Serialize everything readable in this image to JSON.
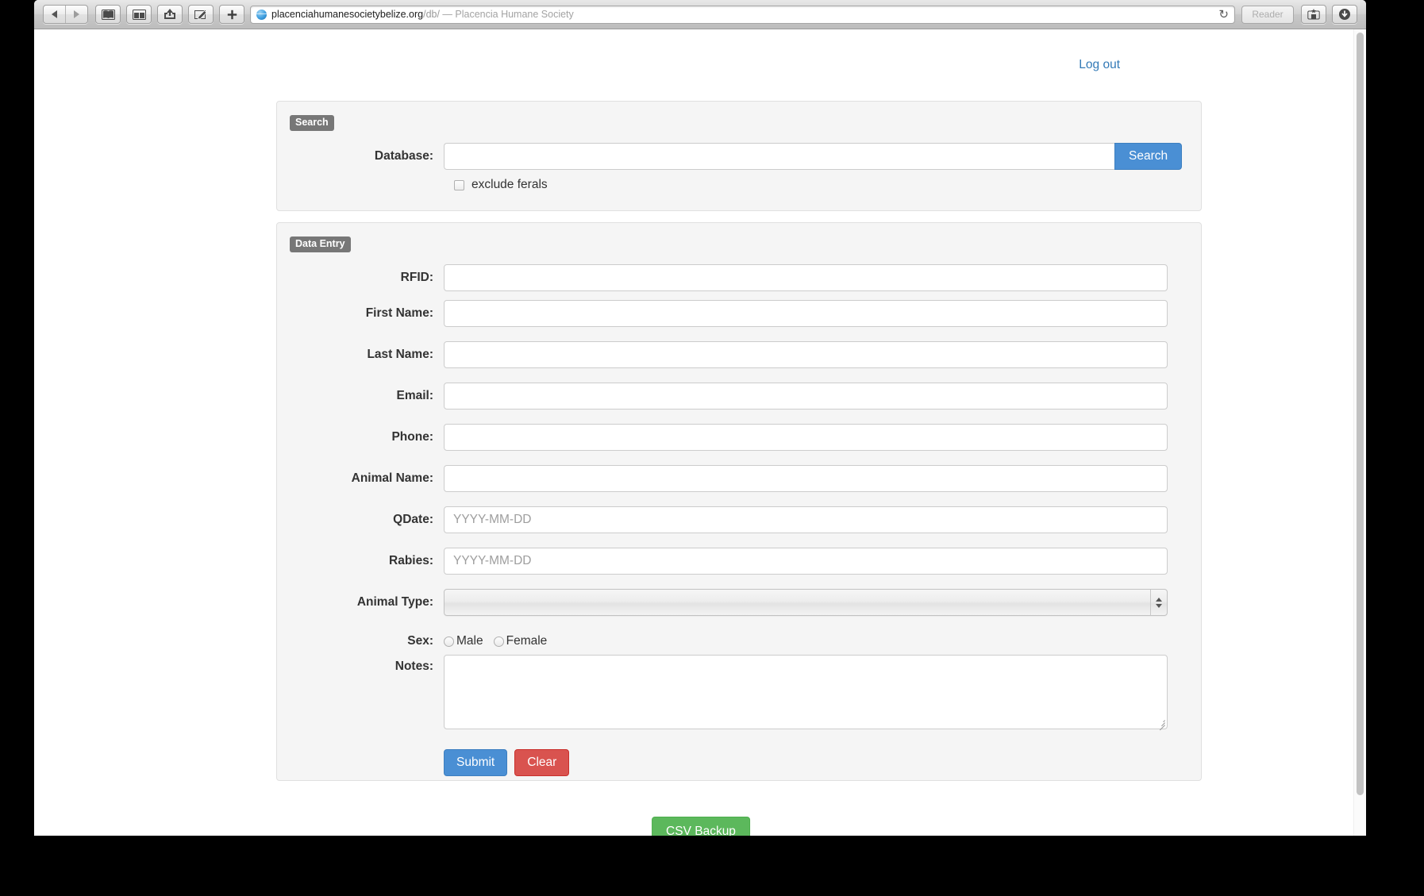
{
  "browser": {
    "nav": {
      "back_icon": "triangle-left",
      "forward_icon": "triangle-right",
      "bookmarks_icon": "open-book",
      "reading_list_icon": "reading-list",
      "share_icon": "share-arrow",
      "compose_icon": "compose-pencil",
      "new_tab_icon": "plus"
    },
    "address": {
      "host": "placenciahumanesocietybelize.org",
      "path": "/db/",
      "title": " — Placencia Humane Society",
      "reload_icon": "↻",
      "site_icon": "globe-icon"
    },
    "reader_label": "Reader",
    "downloads_icon": "download-arrow",
    "share_sheet_icon": "bookmark-add"
  },
  "page": {
    "logout_label": "Log out",
    "search_panel": {
      "legend": "Search",
      "database_label": "Database:",
      "database_value": "",
      "database_placeholder": "",
      "search_button": "Search",
      "exclude_ferals_label": "exclude ferals",
      "exclude_ferals_checked": false
    },
    "entry_panel": {
      "legend": "Data Entry",
      "fields": [
        {
          "label": "RFID:",
          "value": "",
          "placeholder": ""
        },
        {
          "label": "First Name:",
          "value": "",
          "placeholder": ""
        },
        {
          "label": "Last Name:",
          "value": "",
          "placeholder": ""
        },
        {
          "label": "Email:",
          "value": "",
          "placeholder": ""
        },
        {
          "label": "Phone:",
          "value": "",
          "placeholder": ""
        },
        {
          "label": "Animal Name:",
          "value": "",
          "placeholder": ""
        },
        {
          "label": "QDate:",
          "value": "",
          "placeholder": "YYYY-MM-DD"
        },
        {
          "label": "Rabies:",
          "value": "",
          "placeholder": "YYYY-MM-DD"
        }
      ],
      "animal_type_label": "Animal Type:",
      "animal_type_value": "",
      "sex_label": "Sex:",
      "sex_options": [
        {
          "label": "Male",
          "selected": false
        },
        {
          "label": "Female",
          "selected": false
        }
      ],
      "notes_label": "Notes:",
      "notes_value": "",
      "submit_label": "Submit",
      "clear_label": "Clear"
    },
    "csv_backup_label": "CSV Backup"
  },
  "colors": {
    "primary_blue": "#4a8fd4",
    "danger_red": "#d9534f",
    "success_green": "#5cb85c",
    "legend_gray": "#777777",
    "link_blue": "#337ab7",
    "panel_bg": "#f5f5f5"
  }
}
